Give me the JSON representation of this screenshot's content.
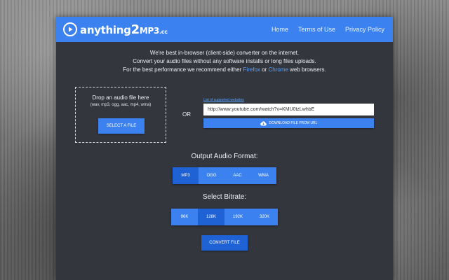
{
  "brand": {
    "name_part1": "anything",
    "name_part2": "2",
    "name_part3": "MP3",
    "name_part4": ".cc",
    "accent_color": "#3b82f0"
  },
  "nav": {
    "items": [
      "Home",
      "Terms of Use",
      "Privacy Policy"
    ]
  },
  "intro": {
    "line1": "We're best in-browser (client-side) converter on the internet.",
    "line2": "Convert your audio files without any software installs or long files uploads.",
    "line3_prefix": "For the best performance we recommend either ",
    "line3_link1": "Firefox",
    "line3_mid": " or ",
    "line3_link2": "Chrome",
    "line3_suffix": " web browsers."
  },
  "upload": {
    "drop_title": "Drop an audio file here",
    "drop_formats": "(wav, mp3, ogg, aac, mp4, wma)",
    "select_button": "SELECT A FILE",
    "or_label": "OR",
    "supported_link": "List of supported websites",
    "url_value": "http://www.youtube.com/watch?v=KMU0tzLwhbE",
    "download_button": "DOWNLOAD FILE FROM URL"
  },
  "output_format": {
    "label": "Output Audio Format:",
    "options": [
      "MP3",
      "OGG",
      "AAC",
      "WMA"
    ],
    "selected": "MP3"
  },
  "bitrate": {
    "label": "Select Bitrate:",
    "options": [
      "96K",
      "128K",
      "192K",
      "320K"
    ],
    "selected": "128K"
  },
  "convert_button": "CONVERT FILE"
}
